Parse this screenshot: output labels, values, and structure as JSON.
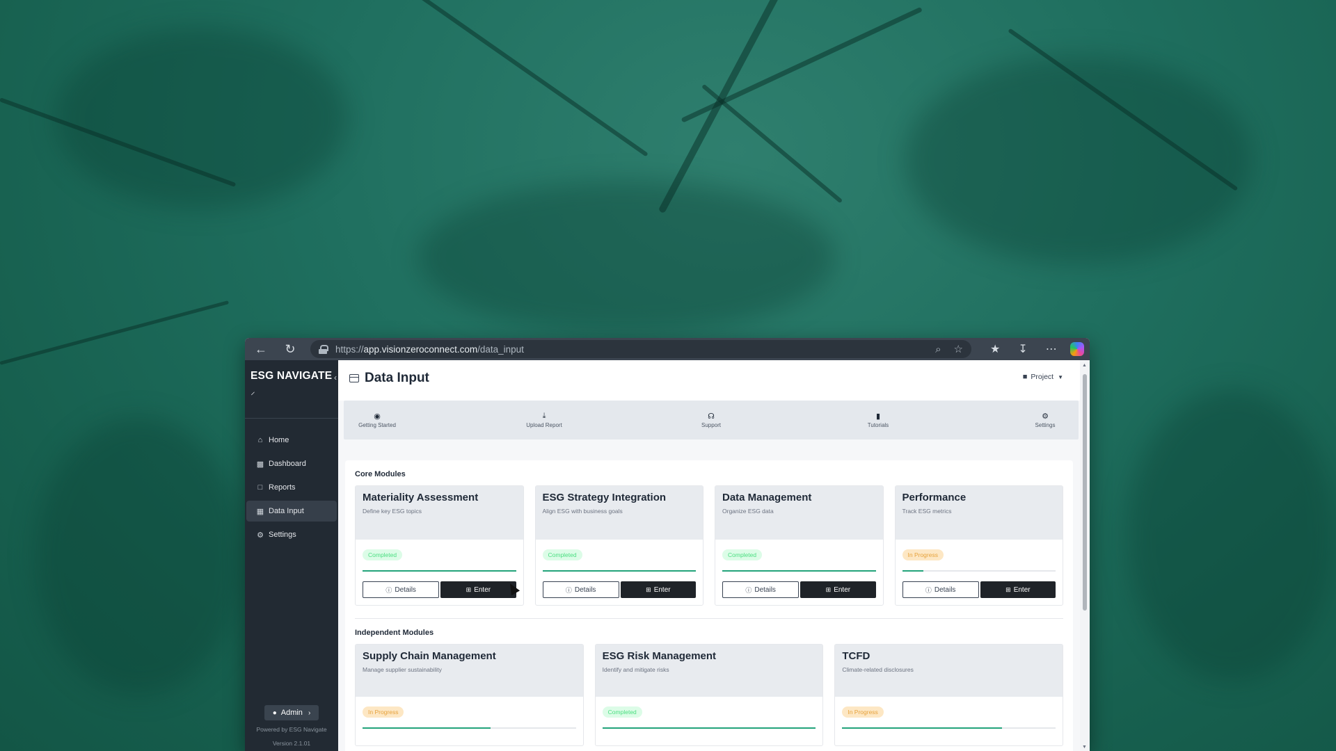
{
  "browser": {
    "url_prefix": "https://",
    "url_domain": "app.visionzeroconnect.com",
    "url_path": "/data_input"
  },
  "sidebar": {
    "brand": "ESG NAVIGATE",
    "items": [
      {
        "label": "Home",
        "icon": "home-icon"
      },
      {
        "label": "Dashboard",
        "icon": "bar-chart-icon"
      },
      {
        "label": "Reports",
        "icon": "document-icon"
      },
      {
        "label": "Data Input",
        "icon": "table-icon",
        "active": true
      },
      {
        "label": "Settings",
        "icon": "gear-icon"
      }
    ],
    "admin_label": "Admin",
    "powered_by": "Powered by ESG Navigate",
    "version": "Version 2.1.01"
  },
  "header": {
    "title": "Data Input",
    "project_label": "Project"
  },
  "quickbar": [
    {
      "label": "Getting Started",
      "icon": "play-circle-icon"
    },
    {
      "label": "Upload Report",
      "icon": "upload-icon"
    },
    {
      "label": "Support",
      "icon": "headset-icon"
    },
    {
      "label": "Tutorials",
      "icon": "video-icon"
    },
    {
      "label": "Settings",
      "icon": "gear-icon"
    }
  ],
  "core": {
    "title": "Core Modules",
    "modules": [
      {
        "title": "Materiality Assessment",
        "subtitle": "Define key ESG topics",
        "status": "Completed",
        "progress": 1.0
      },
      {
        "title": "ESG Strategy Integration",
        "subtitle": "Align ESG with business goals",
        "status": "Completed",
        "progress": 1.0
      },
      {
        "title": "Data Management",
        "subtitle": "Organize ESG data",
        "status": "Completed",
        "progress": 1.0
      },
      {
        "title": "Performance",
        "subtitle": "Track ESG metrics",
        "status": "In Progress",
        "progress": 0.14
      }
    ]
  },
  "independent": {
    "title": "Independent Modules",
    "modules": [
      {
        "title": "Supply Chain Management",
        "subtitle": "Manage supplier sustainability",
        "status": "In Progress",
        "progress": 0.6
      },
      {
        "title": "ESG Risk Management",
        "subtitle": "Identify and mitigate risks",
        "status": "Completed",
        "progress": 1.0
      },
      {
        "title": "TCFD",
        "subtitle": "Climate-related disclosures",
        "status": "In Progress",
        "progress": 0.75
      }
    ]
  },
  "buttons": {
    "details": "Details",
    "enter": "Enter"
  },
  "colors": {
    "accent": "#22a37a",
    "sidebar": "#222a33",
    "completed_bg": "#dcfce7",
    "progress_bg": "#fde7c4"
  }
}
